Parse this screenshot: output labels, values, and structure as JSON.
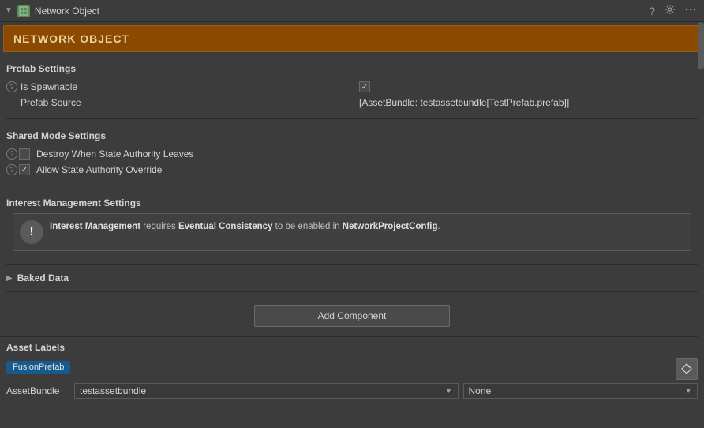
{
  "titleBar": {
    "title": "Network Object",
    "helpBtn": "?",
    "settingsBtn": "⚙"
  },
  "componentHeader": {
    "title": "NETWORK OBJECT"
  },
  "prefabSettings": {
    "sectionLabel": "Prefab Settings",
    "isSpawnableLabel": "Is Spawnable",
    "isSpawnableChecked": true,
    "prefabSourceLabel": "Prefab Source",
    "prefabSourceValue": "[AssetBundle: testassetbundle[TestPrefab.prefab]]"
  },
  "sharedModeSettings": {
    "sectionLabel": "Shared Mode Settings",
    "destroyWhenLabel": "Destroy When State Authority Leaves",
    "destroyWhenChecked": false,
    "allowOverrideLabel": "Allow State Authority Override",
    "allowOverrideChecked": true
  },
  "interestManagement": {
    "sectionLabel": "Interest Management Settings",
    "infoText1": "Interest Management",
    "infoText2": " requires ",
    "infoText3": "Eventual Consistency",
    "infoText4": " to be enabled in ",
    "infoText5": "NetworkProjectConfig",
    "infoText6": "."
  },
  "bakedData": {
    "sectionLabel": "Baked Data"
  },
  "addComponent": {
    "buttonLabel": "Add Component"
  },
  "assetLabels": {
    "sectionLabel": "Asset Labels",
    "tagName": "FusionPrefab",
    "assetBundleLabel": "AssetBundle",
    "assetBundleValue": "testassetbundle",
    "noneValue": "None"
  }
}
